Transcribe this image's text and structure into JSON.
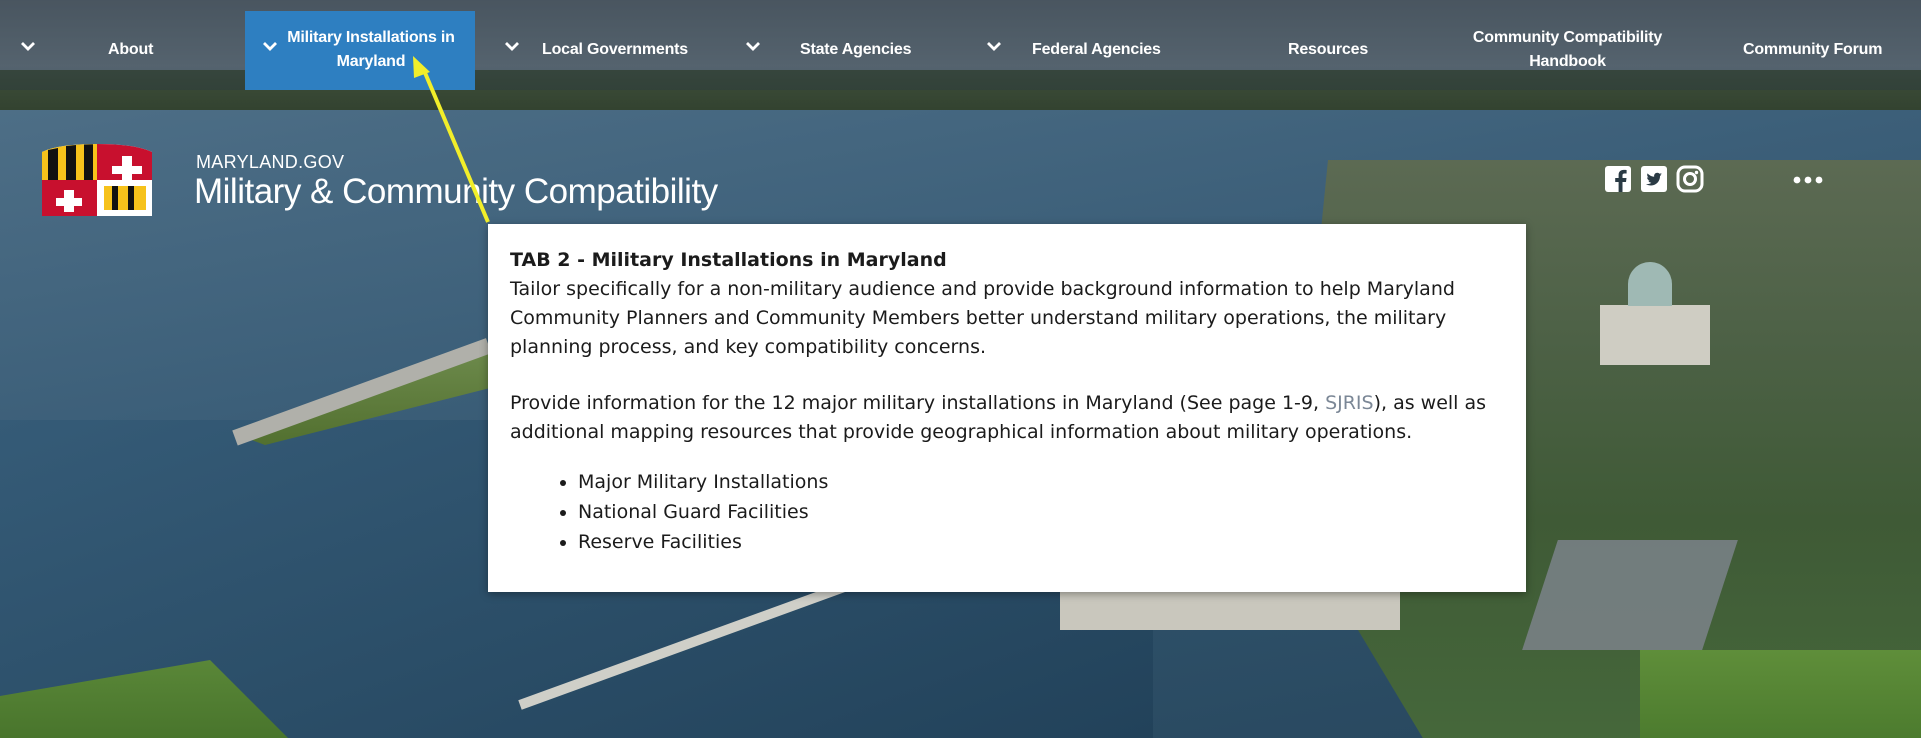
{
  "nav": {
    "items": [
      {
        "label": "About",
        "has_chevron": true
      },
      {
        "label": "Military Installations in Maryland",
        "has_chevron": true,
        "active": true
      },
      {
        "label": "Local Governments",
        "has_chevron": true
      },
      {
        "label": "State Agencies",
        "has_chevron": true
      },
      {
        "label": "Federal Agencies",
        "has_chevron": true
      },
      {
        "label": "Resources",
        "has_chevron": false
      },
      {
        "label": "Community Compatibility Handbook",
        "has_chevron": false
      },
      {
        "label": "Community Forum",
        "has_chevron": false
      }
    ],
    "active_color": "#2e7fc1"
  },
  "brand": {
    "subtitle": "MARYLAND.GOV",
    "title": "Military & Community Compatibility"
  },
  "social": {
    "icons": [
      "facebook-icon",
      "twitter-icon",
      "instagram-icon"
    ],
    "more": "more-options-icon"
  },
  "annotation": {
    "arrow_color": "#f2ee2a"
  },
  "callout": {
    "title": "TAB 2 - Military Installations in Maryland",
    "paragraph1": "Tailor specifically for a non-military audience and provide background information to help Maryland Community Planners and Community Members better understand military operations, the military planning process, and key compatibility concerns.",
    "paragraph2_before": "Provide information for the 12 major military installations in Maryland (See page 1-9, ",
    "paragraph2_link": "SJRIS",
    "paragraph2_after": "), as well as additional mapping resources that provide geographical information about military operations.",
    "bullets": [
      "Major Military Installations",
      "National Guard Facilities",
      "Reserve Facilities"
    ]
  }
}
